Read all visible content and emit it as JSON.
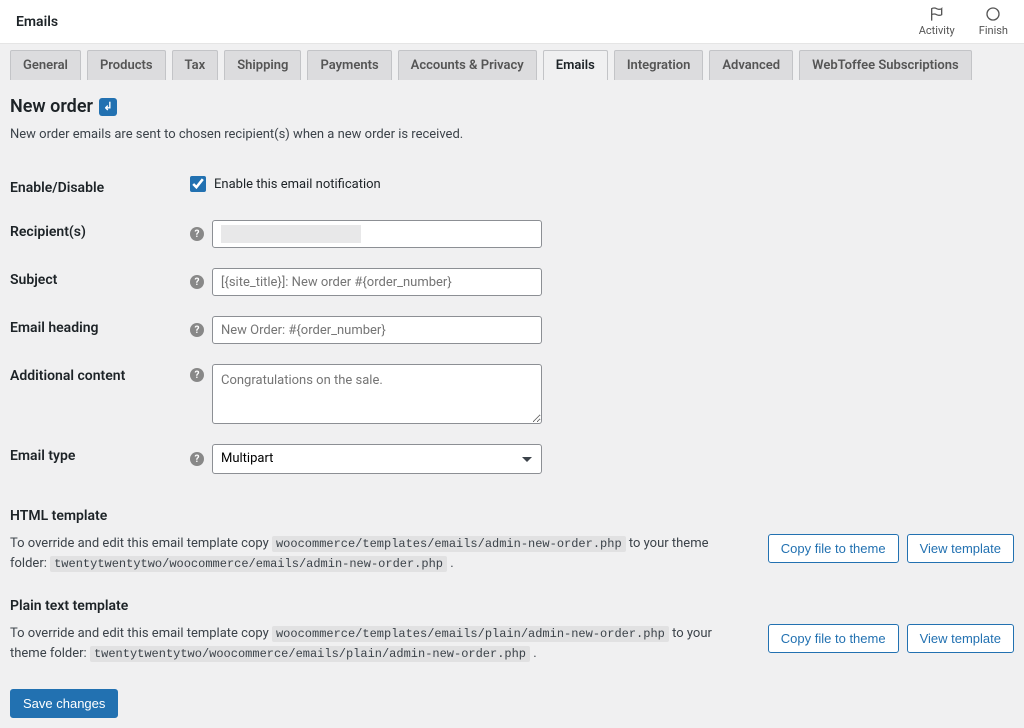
{
  "top": {
    "title": "Emails",
    "icons": [
      {
        "name": "activity-icon",
        "label": "Activity"
      },
      {
        "name": "finish-icon",
        "label": "Finish"
      }
    ]
  },
  "tabs": [
    {
      "id": "general",
      "label": "General",
      "active": false
    },
    {
      "id": "products",
      "label": "Products",
      "active": false
    },
    {
      "id": "tax",
      "label": "Tax",
      "active": false
    },
    {
      "id": "shipping",
      "label": "Shipping",
      "active": false
    },
    {
      "id": "payments",
      "label": "Payments",
      "active": false
    },
    {
      "id": "accounts",
      "label": "Accounts & Privacy",
      "active": false
    },
    {
      "id": "emails",
      "label": "Emails",
      "active": true
    },
    {
      "id": "integration",
      "label": "Integration",
      "active": false
    },
    {
      "id": "advanced",
      "label": "Advanced",
      "active": false
    },
    {
      "id": "webtoffee",
      "label": "WebToffee Subscriptions",
      "active": false
    }
  ],
  "page": {
    "title": "New order",
    "desc": "New order emails are sent to chosen recipient(s) when a new order is received."
  },
  "fields": {
    "enable": {
      "label": "Enable/Disable",
      "checkbox_label": "Enable this email notification",
      "checked": true
    },
    "recipients": {
      "label": "Recipient(s)",
      "value": ""
    },
    "subject": {
      "label": "Subject",
      "placeholder": "[{site_title}]: New order #{order_number}",
      "value": ""
    },
    "heading": {
      "label": "Email heading",
      "placeholder": "New Order: #{order_number}",
      "value": ""
    },
    "additional": {
      "label": "Additional content",
      "placeholder": "Congratulations on the sale.",
      "value": ""
    },
    "type": {
      "label": "Email type",
      "selected": "Multipart"
    }
  },
  "templates": {
    "html": {
      "title": "HTML template",
      "pre": "To override and edit this email template copy ",
      "src": "woocommerce/templates/emails/admin-new-order.php",
      "mid": " to your theme folder: ",
      "dst": "twentytwentytwo/woocommerce/emails/admin-new-order.php"
    },
    "plain": {
      "title": "Plain text template",
      "pre": "To override and edit this email template copy ",
      "src": "woocommerce/templates/emails/plain/admin-new-order.php",
      "mid": " to your theme folder: ",
      "dst": "twentytwentytwo/woocommerce/emails/plain/admin-new-order.php"
    },
    "buttons": {
      "copy": "Copy file to theme",
      "view": "View template"
    }
  },
  "save_label": "Save changes"
}
